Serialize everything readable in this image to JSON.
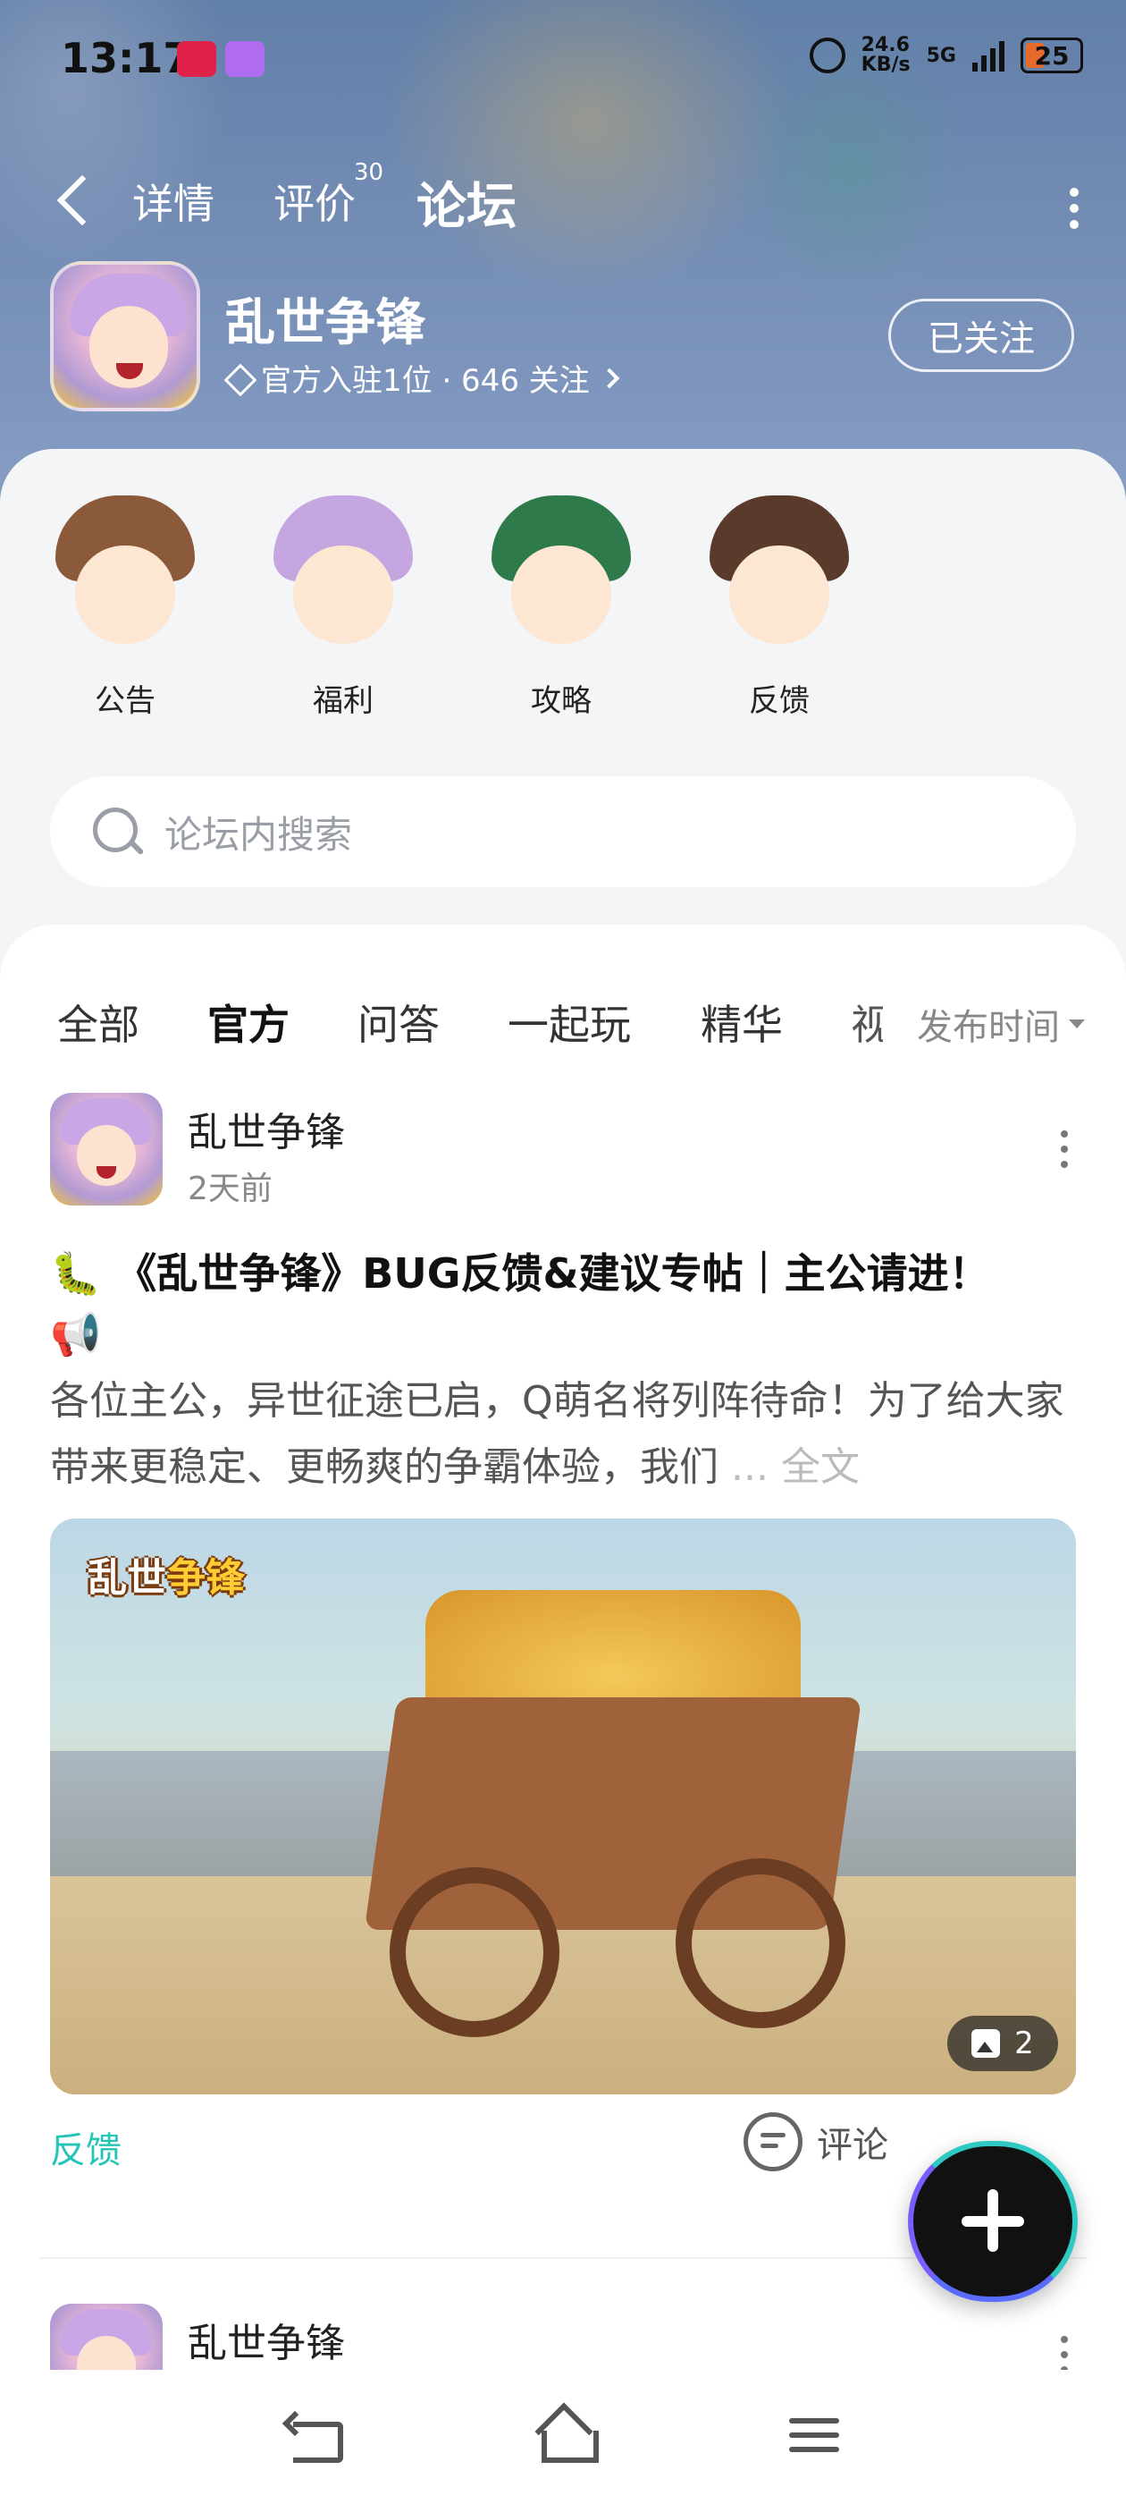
{
  "status_bar": {
    "time": "13:17",
    "net_speed_value": "24.6",
    "net_speed_unit": "KB/s",
    "network": "5G",
    "battery": "25",
    "icons": [
      "tmall-app-icon",
      "purple-app-icon",
      "alarm-icon",
      "signal-icon",
      "battery-icon"
    ]
  },
  "top_nav": {
    "tabs": [
      {
        "label": "详情"
      },
      {
        "label": "评价",
        "count": "30"
      },
      {
        "label": "论坛"
      }
    ],
    "active_tab": "论坛",
    "accent": "#22d6c6"
  },
  "game": {
    "title": "乱世争锋",
    "meta": "官方入驻1位 · 646 关注",
    "follow_label": "已关注"
  },
  "categories": [
    {
      "label": "公告",
      "icon": "announcement-avatar"
    },
    {
      "label": "福利",
      "icon": "benefits-avatar"
    },
    {
      "label": "攻略",
      "icon": "guide-avatar"
    },
    {
      "label": "反馈",
      "icon": "feedback-avatar"
    }
  ],
  "search": {
    "placeholder": "论坛内搜索"
  },
  "filter": {
    "tabs": [
      "全部",
      "官方",
      "问答",
      "一起玩",
      "精华",
      "视"
    ],
    "active_tab": "官方",
    "sort_label": "发布时间"
  },
  "posts": [
    {
      "author": "乱世争锋",
      "time": "2天前",
      "title_emoji_start": "🐛",
      "title": "《乱世争锋》BUG反馈&建议专帖｜主公请进！",
      "title_emoji_end": "📢",
      "excerpt": "各位主公，异世征途已启，Q萌名将列阵待命！为了给大家带来更稳定、更畅爽的争霸体验，我们",
      "more_label": "... 全文",
      "image_logo_part1": "乱世",
      "image_logo_part2": "争锋",
      "image_count": "2",
      "tag": "反馈",
      "comment_label": "评论"
    },
    {
      "author": "乱世争锋"
    }
  ],
  "colors": {
    "accent": "#22d6c6",
    "tag": "#22c5b6"
  }
}
